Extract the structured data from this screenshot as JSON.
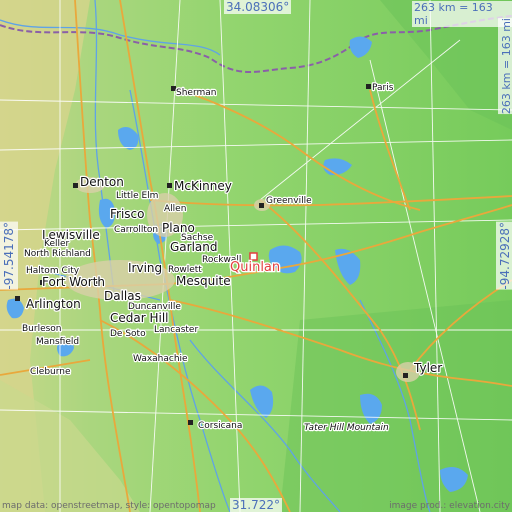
{
  "map": {
    "place": "Quinlan",
    "coordinates": {
      "north": "34.08306°",
      "south": "31.722°",
      "west": "-97.54178°",
      "east": "-94.72928°"
    },
    "scale": {
      "top": "263 km = 163 mi",
      "right": "263 km = 163 mi"
    },
    "credits": {
      "left": "map data: openstreetmap, style: opentopomap",
      "right": "image prod.: elevation.city"
    },
    "cities": {
      "denton": "Denton",
      "mckinney": "McKinney",
      "little_elm": "Little Elm",
      "frisco": "Frisco",
      "allen": "Allen",
      "carrollton": "Carrollton",
      "lewisville": "Lewisville",
      "keller": "Keller",
      "north_richland": "North Richland",
      "haltom_city": "Haltom City",
      "fort_worth": "Fort Worth",
      "arlington": "Arlington",
      "irving": "Irving",
      "dallas": "Dallas",
      "cedar_hill": "Cedar Hill",
      "plano": "Plano",
      "sachse": "Sachse",
      "garland": "Garland",
      "rockwall": "Rockwall",
      "rowlett": "Rowlett",
      "mesquite": "Mesquite",
      "sherman": "Sherman",
      "paris": "Paris",
      "greenville": "Greenville",
      "quinlan": "Quinlan",
      "tyler": "Tyler",
      "corsicana": "Corsicana",
      "waxahachie": "Waxahachie",
      "duncanville": "Duncanville",
      "lancaster": "Lancaster",
      "de_soto": "De Soto",
      "burleson": "Burleson",
      "mansfield": "Mansfield",
      "cleburne": "Cleburne",
      "tater_hill": "Tater Hill Mountain"
    }
  }
}
